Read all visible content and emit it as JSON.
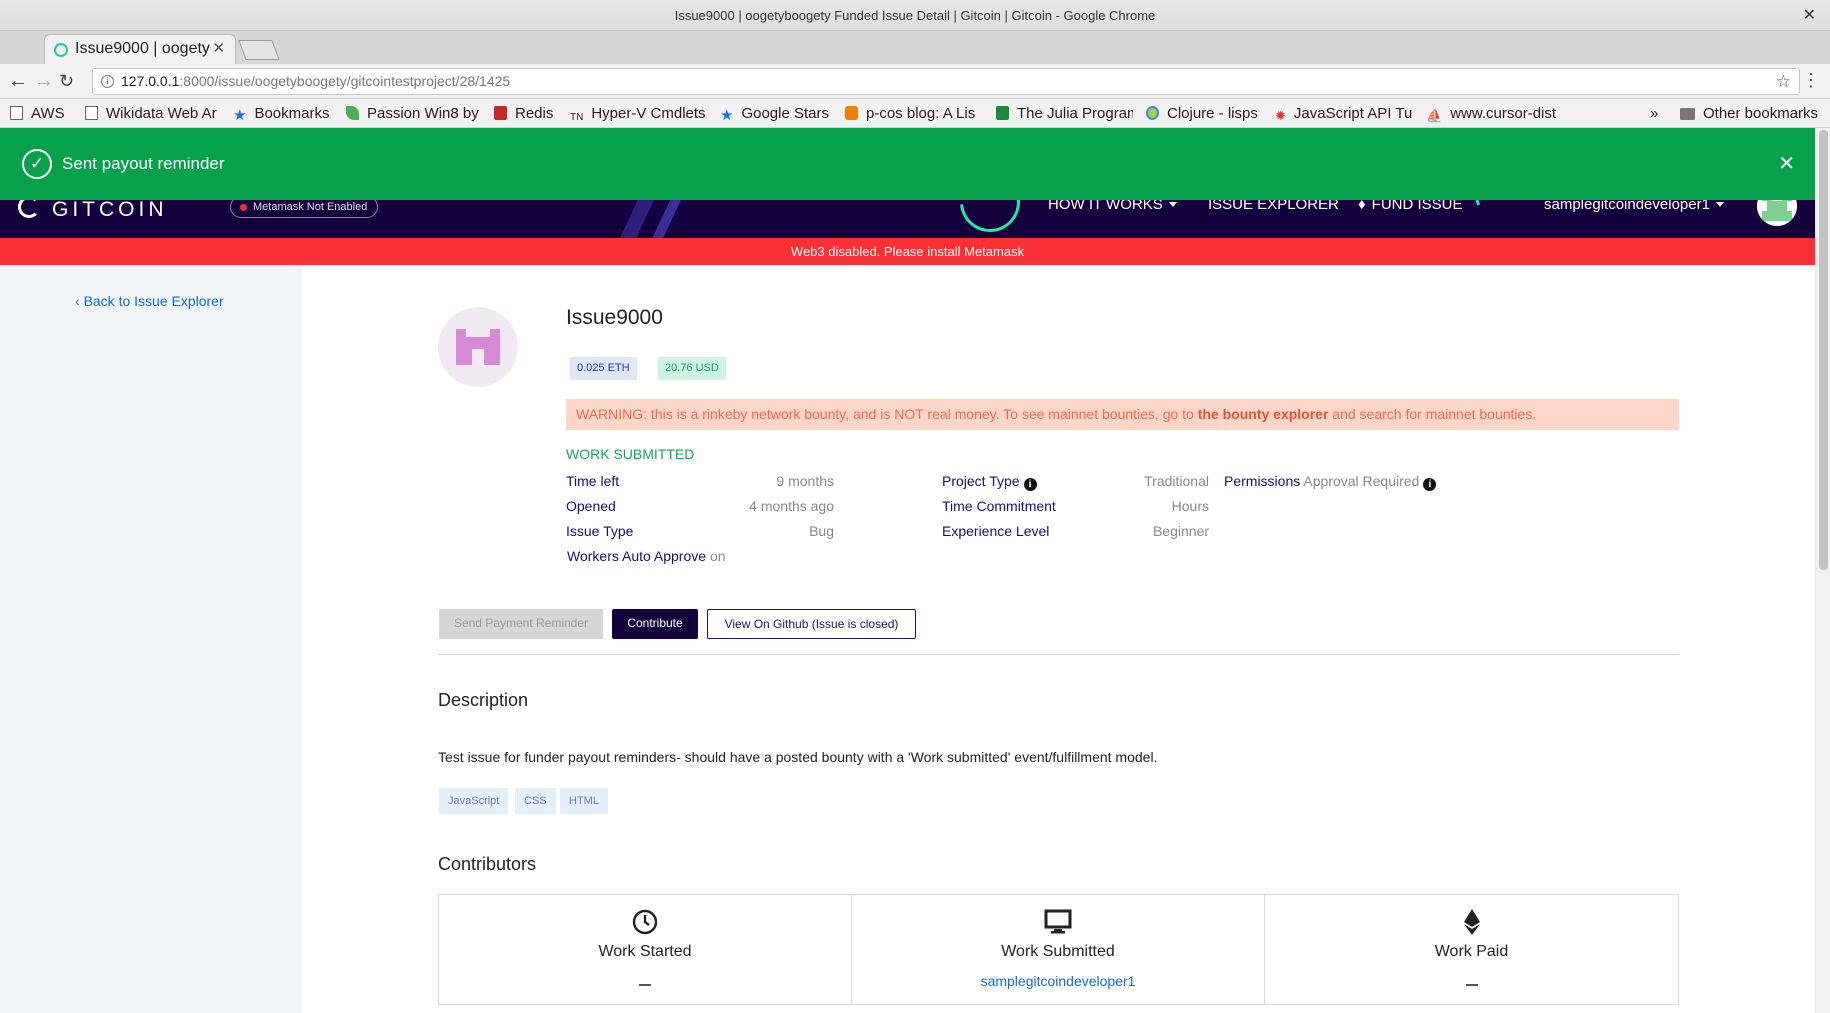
{
  "browser": {
    "window_title": "Issue9000 | oogetyboogety Funded Issue Detail | Gitcoin | Gitcoin - Google Chrome",
    "tab_title": "Issue9000 | oogety",
    "url_host": "127.0.0.1",
    "url_rest": ":8000/issue/oogetyboogety/gitcointestproject/28/1425",
    "bookmarks": [
      {
        "label": "AWS",
        "icon": "page-icon"
      },
      {
        "label": "Wikidata Web Ar",
        "icon": "page-icon"
      },
      {
        "label": "Bookmarks",
        "icon": "star-icon"
      },
      {
        "label": "Passion Win8 by",
        "icon": "leaf-icon"
      },
      {
        "label": "Redis",
        "icon": "redis-icon"
      },
      {
        "label": "Hyper-V Cmdlets",
        "icon": "tn-icon"
      },
      {
        "label": "Google Stars",
        "icon": "star-icon"
      },
      {
        "label": "p-cos blog: A Lis",
        "icon": "blogger-icon"
      },
      {
        "label": "The Julia Program",
        "icon": "np-icon"
      },
      {
        "label": "Clojure - lisps",
        "icon": "clojure-icon"
      },
      {
        "label": "JavaScript API Tu",
        "icon": "gear-icon"
      },
      {
        "label": "www.cursor-dist",
        "icon": "sail-icon"
      }
    ],
    "overflow_label": "»",
    "other_bookmarks": "Other bookmarks"
  },
  "alert": {
    "message": "Sent payout reminder",
    "color": "#08a14b"
  },
  "nav": {
    "logo_text": "GITCOIN",
    "metamask_badge": "Metamask Not Enabled",
    "how_it_works": "HOW IT WORKS",
    "issue_explorer": "ISSUE EXPLORER",
    "fund_issue": "FUND ISSUE",
    "username": "samplegitcoindeveloper1",
    "bg_color": "#15003e"
  },
  "web3_banner": "Web3 disabled. Please install Metamask",
  "sidebar": {
    "back_link": "Back to Issue Explorer"
  },
  "issue": {
    "title": "Issue9000",
    "amount_eth": "0.025 ETH",
    "amount_usd": "20.76 USD",
    "warning_pre": "WARNING: this is a rinkeby network bounty, and is NOT real money. To see mainnet bounties, go to ",
    "warning_link": "the bounty explorer",
    "warning_post": " and search for mainnet bounties.",
    "status": "WORK SUBMITTED",
    "details": {
      "time_left_label": "Time left",
      "time_left": "9 months",
      "opened_label": "Opened",
      "opened": "4 months ago",
      "issue_type_label": "Issue Type",
      "issue_type": "Bug",
      "auto_approve_label": "Workers Auto Approve",
      "auto_approve": "on",
      "project_type_label": "Project Type",
      "project_type": "Traditional",
      "time_commitment_label": "Time Commitment",
      "time_commitment": "Hours",
      "experience_label": "Experience Level",
      "experience": "Beginner",
      "permissions_label": "Permissions",
      "permissions": "Approval Required"
    },
    "buttons": {
      "reminder": "Send Payment Reminder",
      "contribute": "Contribute",
      "github": "View On Github (Issue is closed)"
    },
    "description_heading": "Description",
    "description": "Test issue for funder payout reminders- should have a posted bounty with a 'Work submitted' event/fulfillment model.",
    "tags": [
      "JavaScript",
      "CSS",
      "HTML"
    ],
    "contributors_heading": "Contributors",
    "contributors": {
      "started_label": "Work Started",
      "submitted_label": "Work Submitted",
      "submitted_user": "samplegitcoindeveloper1",
      "paid_label": "Work Paid"
    }
  }
}
